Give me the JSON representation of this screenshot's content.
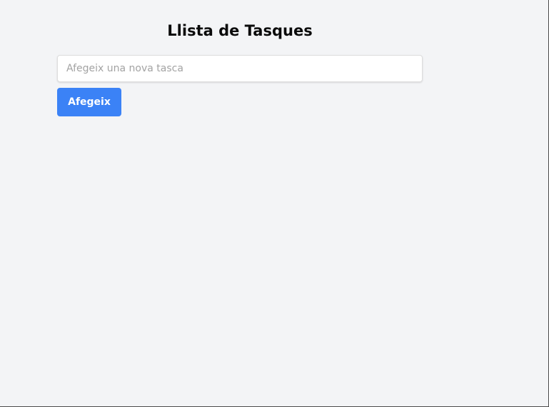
{
  "app": {
    "title": "Llista de Tasques"
  },
  "task_form": {
    "input_value": "",
    "input_placeholder": "Afegeix una nova tasca",
    "add_button_label": "Afegeix"
  },
  "tasks": [],
  "colors": {
    "background": "#f3f4f6",
    "accent": "#3b82f6",
    "button_text": "#ffffff"
  }
}
